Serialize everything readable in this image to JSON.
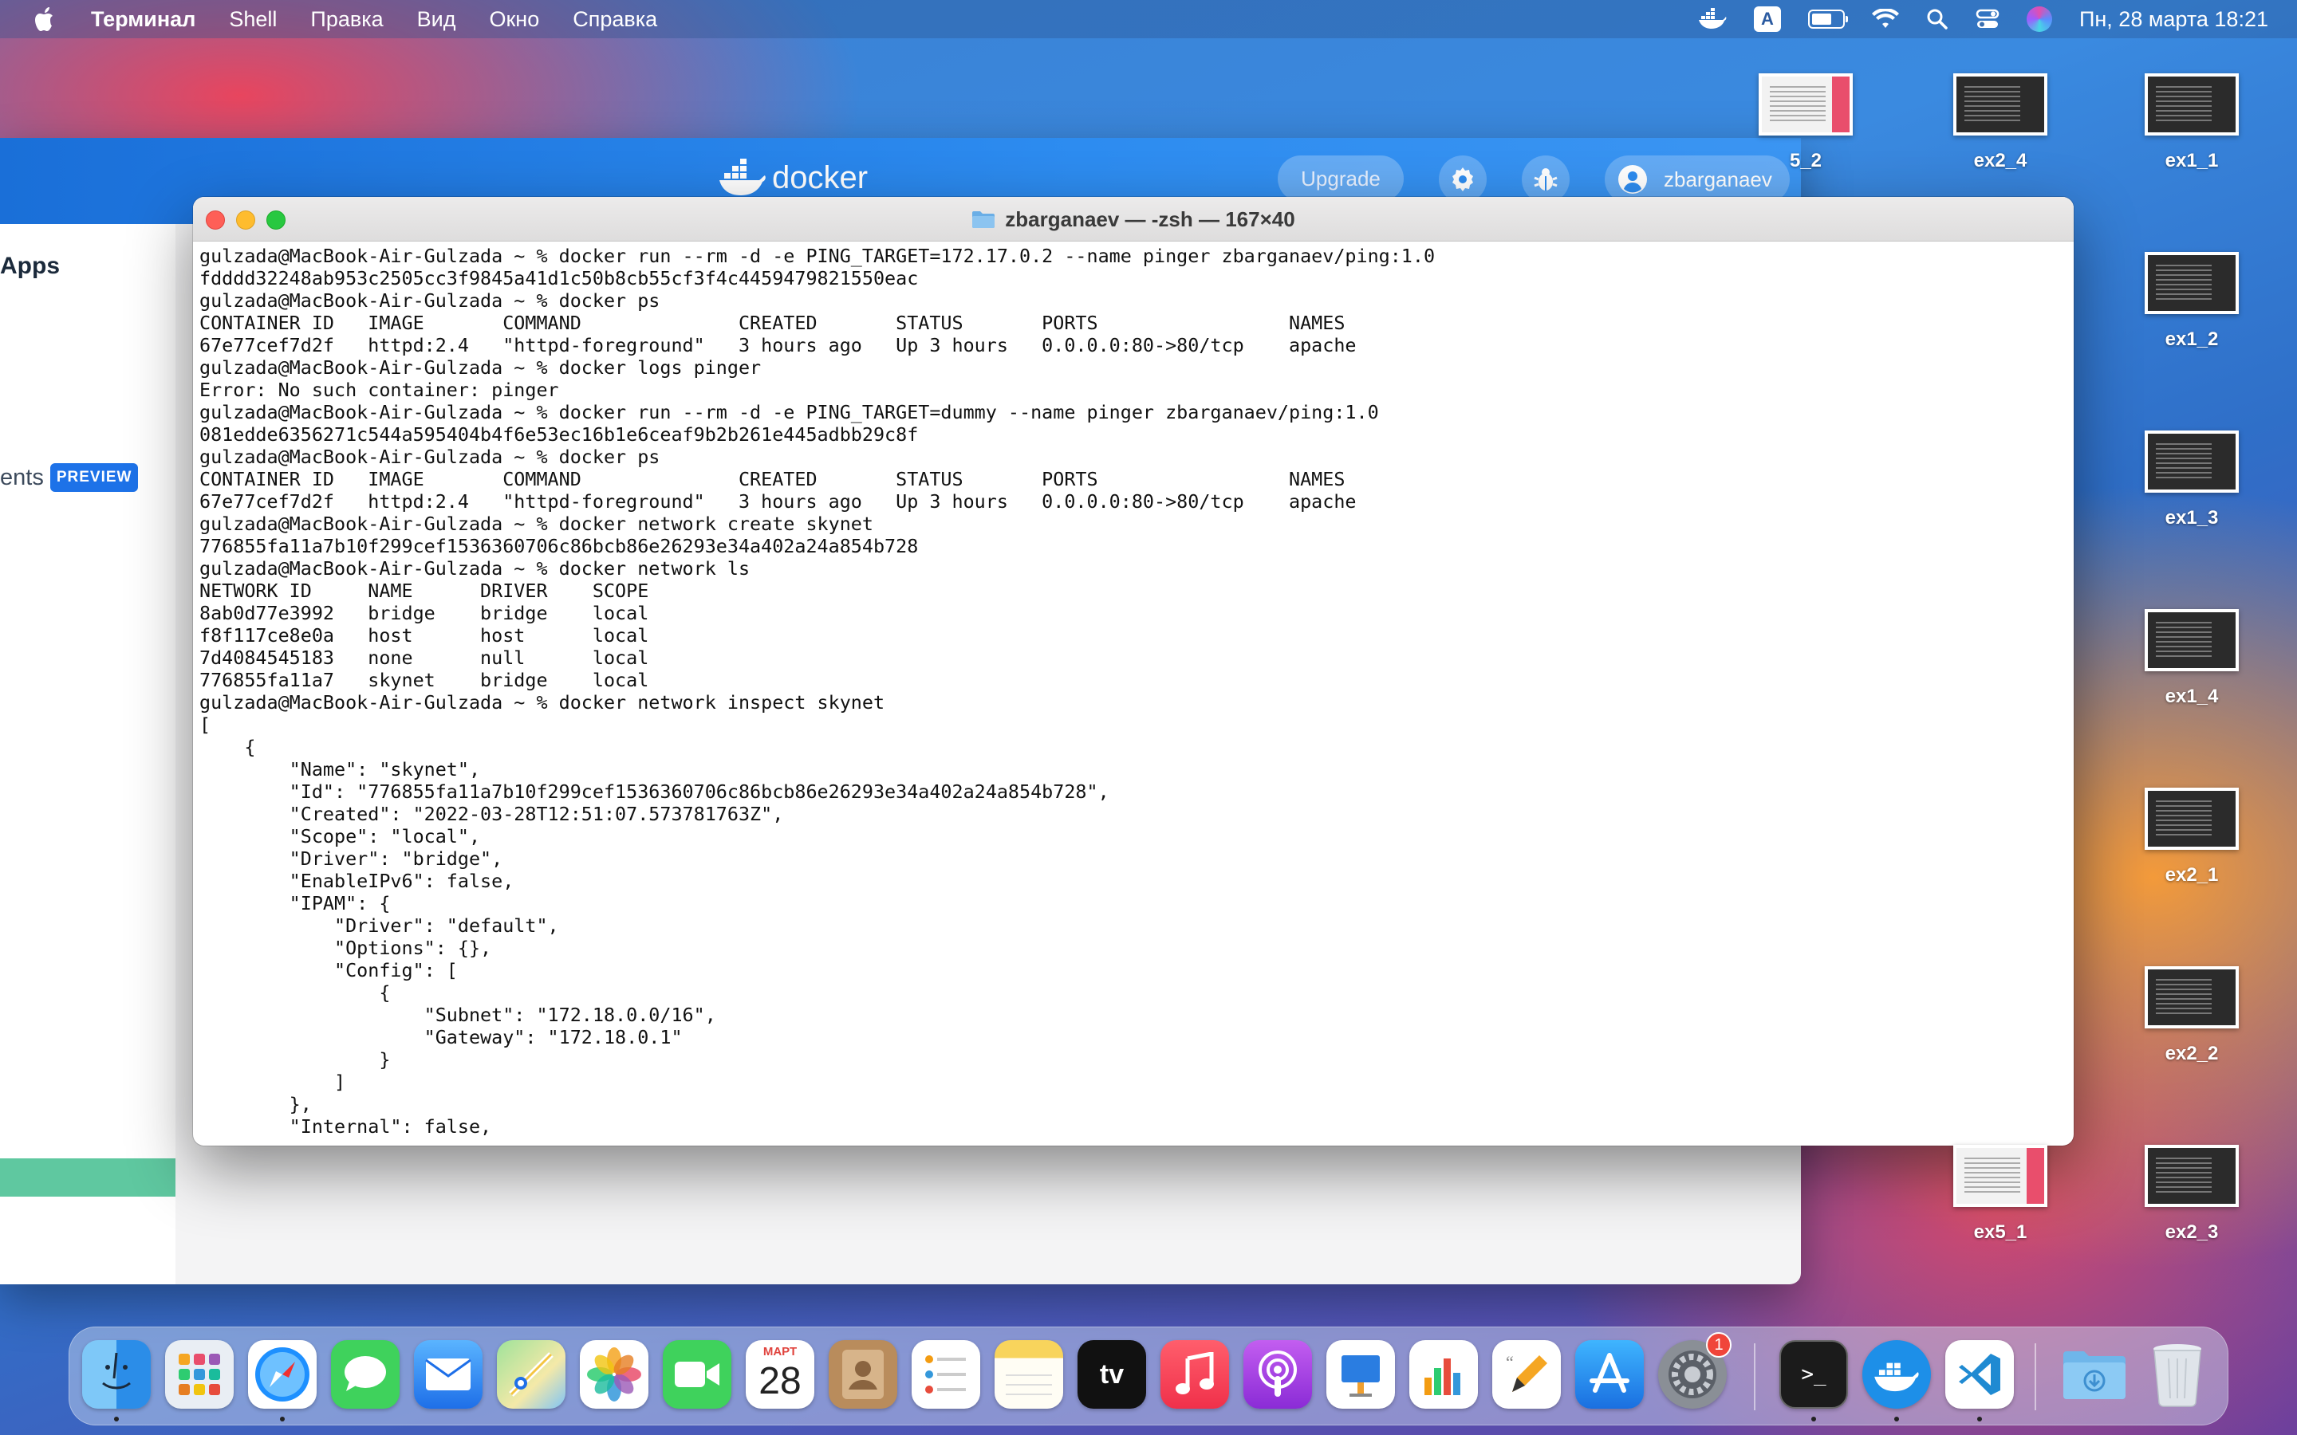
{
  "menubar": {
    "app_name": "Терминал",
    "menus": [
      "Shell",
      "Правка",
      "Вид",
      "Окно",
      "Справка"
    ],
    "input_source": "A",
    "clock": "Пн, 28 марта  18:21"
  },
  "docker": {
    "logo_text": "docker",
    "upgrade_label": "Upgrade",
    "username": "zbarganaev",
    "sidebar_apps": "Apps",
    "sidebar_partial_item": "ents",
    "preview_badge": "PREVIEW"
  },
  "terminal": {
    "title": "zbarganaev — -zsh — 167×40",
    "lines": [
      "gulzada@MacBook-Air-Gulzada ~ % docker run --rm -d -e PING_TARGET=172.17.0.2 --name pinger zbarganaev/ping:1.0",
      "fdddd32248ab953c2505cc3f9845a41d1c50b8cb55cf3f4c4459479821550eac",
      "gulzada@MacBook-Air-Gulzada ~ % docker ps",
      "CONTAINER ID   IMAGE       COMMAND              CREATED       STATUS       PORTS                 NAMES",
      "67e77cef7d2f   httpd:2.4   \"httpd-foreground\"   3 hours ago   Up 3 hours   0.0.0.0:80->80/tcp    apache",
      "gulzada@MacBook-Air-Gulzada ~ % docker logs pinger",
      "Error: No such container: pinger",
      "gulzada@MacBook-Air-Gulzada ~ % docker run --rm -d -e PING_TARGET=dummy --name pinger zbarganaev/ping:1.0",
      "081edde6356271c544a595404b4f6e53ec16b1e6ceaf9b2b261e445adbb29c8f",
      "gulzada@MacBook-Air-Gulzada ~ % docker ps",
      "CONTAINER ID   IMAGE       COMMAND              CREATED       STATUS       PORTS                 NAMES",
      "67e77cef7d2f   httpd:2.4   \"httpd-foreground\"   3 hours ago   Up 3 hours   0.0.0.0:80->80/tcp    apache",
      "gulzada@MacBook-Air-Gulzada ~ % docker network create skynet",
      "776855fa11a7b10f299cef1536360706c86bcb86e26293e34a402a24a854b728",
      "gulzada@MacBook-Air-Gulzada ~ % docker network ls",
      "NETWORK ID     NAME      DRIVER    SCOPE",
      "8ab0d77e3992   bridge    bridge    local",
      "f8f117ce8e0a   host      host      local",
      "7d4084545183   none      null      local",
      "776855fa11a7   skynet    bridge    local",
      "gulzada@MacBook-Air-Gulzada ~ % docker network inspect skynet",
      "[",
      "    {",
      "        \"Name\": \"skynet\",",
      "        \"Id\": \"776855fa11a7b10f299cef1536360706c86bcb86e26293e34a402a24a854b728\",",
      "        \"Created\": \"2022-03-28T12:51:07.573781763Z\",",
      "        \"Scope\": \"local\",",
      "        \"Driver\": \"bridge\",",
      "        \"EnableIPv6\": false,",
      "        \"IPAM\": {",
      "            \"Driver\": \"default\",",
      "            \"Options\": {},",
      "            \"Config\": [",
      "                {",
      "                    \"Subnet\": \"172.18.0.0/16\",",
      "                    \"Gateway\": \"172.18.0.1\"",
      "                }",
      "            ]",
      "        },",
      "        \"Internal\": false,"
    ]
  },
  "desktop_icons": [
    {
      "label": "5_2",
      "style": "light"
    },
    {
      "label": "ex2_4",
      "style": "dark"
    },
    {
      "label": "ex1_1",
      "style": "dark"
    },
    {
      "label": "ex1_2",
      "style": "dark"
    },
    {
      "label": "ex1_3",
      "style": "dark"
    },
    {
      "label": "ex1_4",
      "style": "dark"
    },
    {
      "label": "ex2_1",
      "style": "dark"
    },
    {
      "label": "ex2_2",
      "style": "dark"
    },
    {
      "label": "ex5_1",
      "style": "light"
    },
    {
      "label": "ex2_3",
      "style": "dark"
    }
  ],
  "dock": {
    "calendar_month": "МАРТ",
    "calendar_day": "28",
    "settings_badge": "1",
    "terminal_glyph": ">_",
    "apps": [
      "finder-icon",
      "launchpad-icon",
      "safari-icon",
      "messages-icon",
      "mail-icon",
      "maps-icon",
      "photos-icon",
      "facetime-icon",
      "calendar-icon",
      "contacts-icon",
      "reminders-icon",
      "notes-icon",
      "apple-tv-icon",
      "music-icon",
      "podcasts-icon",
      "keynote-icon",
      "numbers-icon",
      "pages-icon",
      "app-store-icon",
      "system-preferences-icon",
      "terminal-icon",
      "docker-icon",
      "vscode-icon",
      "downloads-folder-icon",
      "trash-icon"
    ]
  },
  "colors": {
    "docker_blue": "#2d8cf0",
    "terminal_bg": "#ffffff",
    "close": "#fe5f57",
    "minimize": "#febc2e",
    "zoom": "#28c840"
  }
}
